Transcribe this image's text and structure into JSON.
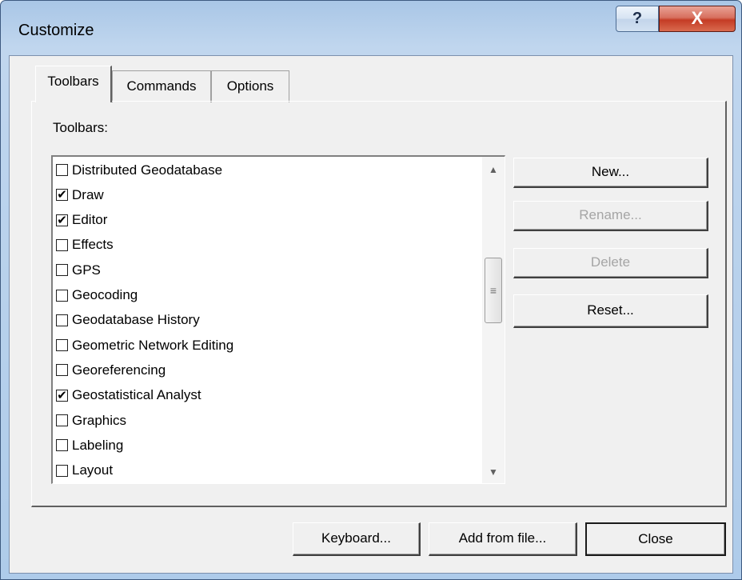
{
  "window": {
    "title": "Customize",
    "help_label": "?",
    "close_label": "X"
  },
  "tabs": [
    {
      "label": "Toolbars",
      "active": true
    },
    {
      "label": "Commands",
      "active": false
    },
    {
      "label": "Options",
      "active": false
    }
  ],
  "toolbars_label": "Toolbars:",
  "toolbar_list": [
    {
      "label": "Distributed Geodatabase",
      "checked": false
    },
    {
      "label": "Draw",
      "checked": true
    },
    {
      "label": "Editor",
      "checked": true
    },
    {
      "label": "Effects",
      "checked": false
    },
    {
      "label": "GPS",
      "checked": false
    },
    {
      "label": "Geocoding",
      "checked": false
    },
    {
      "label": "Geodatabase History",
      "checked": false
    },
    {
      "label": "Geometric Network Editing",
      "checked": false
    },
    {
      "label": "Georeferencing",
      "checked": false
    },
    {
      "label": "Geostatistical Analyst",
      "checked": true
    },
    {
      "label": "Graphics",
      "checked": false
    },
    {
      "label": "Labeling",
      "checked": false
    },
    {
      "label": "Layout",
      "checked": false
    }
  ],
  "scrollbar": {
    "up_icon": "▲",
    "down_icon": "▼",
    "grip": "≡"
  },
  "side_buttons": {
    "new": "New...",
    "rename": "Rename...",
    "delete": "Delete",
    "reset": "Reset..."
  },
  "bottom_buttons": {
    "keyboard": "Keyboard...",
    "add_from_file": "Add from file...",
    "close": "Close"
  },
  "check_glyph": "✔"
}
